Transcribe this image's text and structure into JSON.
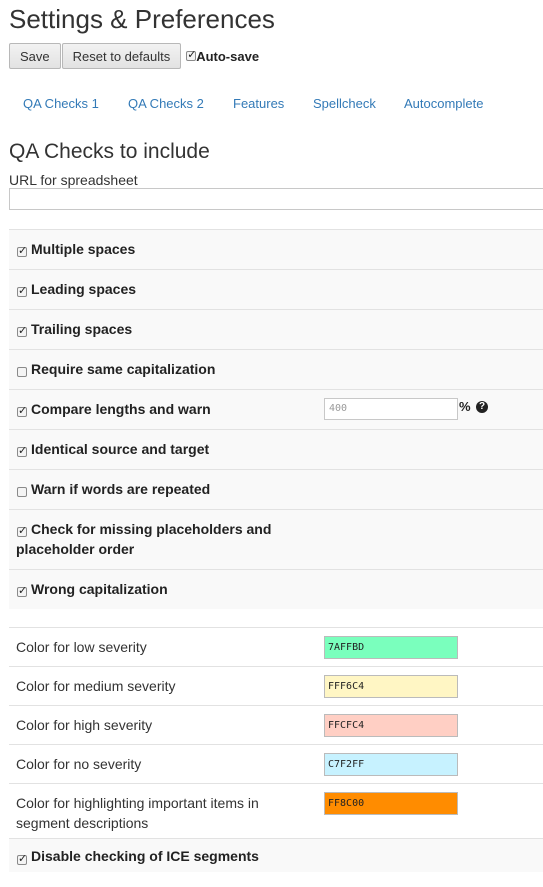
{
  "page_title": "Settings & Preferences",
  "toolbar": {
    "save_label": "Save",
    "reset_label": "Reset to defaults",
    "autosave_label": "Auto-save",
    "autosave_checked": true
  },
  "tabs": [
    {
      "label": "QA Checks 1"
    },
    {
      "label": "QA Checks 2"
    },
    {
      "label": "Features"
    },
    {
      "label": "Spellcheck"
    },
    {
      "label": "Autocomplete"
    }
  ],
  "section_title": "QA Checks to include",
  "url": {
    "label": "URL for spreadsheet",
    "value": ""
  },
  "checks": [
    {
      "label": "Multiple spaces",
      "checked": true
    },
    {
      "label": "Leading spaces",
      "checked": true
    },
    {
      "label": "Trailing spaces",
      "checked": true
    },
    {
      "label": "Require same capitalization",
      "checked": false
    },
    {
      "label": "Compare lengths and warn",
      "checked": true,
      "input_value": "400",
      "suffix": "%",
      "help_icon": "question-circle-icon"
    },
    {
      "label": "Identical source and target",
      "checked": true
    },
    {
      "label": "Warn if words are repeated",
      "checked": false
    },
    {
      "label": "Check for missing placeholders and placeholder order",
      "checked": true
    },
    {
      "label": "Wrong capitalization",
      "checked": true
    }
  ],
  "colors": [
    {
      "label": "Color for low severity",
      "value": "7AFFBD",
      "color": "#7AFFBD"
    },
    {
      "label": "Color for medium severity",
      "value": "FFF6C4",
      "color": "#FFF6C4"
    },
    {
      "label": "Color for high severity",
      "value": "FFCFC4",
      "color": "#FFCFC4"
    },
    {
      "label": "Color for no severity",
      "value": "C7F2FF",
      "color": "#C7F2FF"
    },
    {
      "label": "Color for highlighting important items in segment descriptions",
      "value": "FF8C00",
      "color": "#FF8C00"
    }
  ],
  "ice": {
    "label": "Disable checking of ICE segments",
    "checked": true
  },
  "accent_color": "#337ab7"
}
